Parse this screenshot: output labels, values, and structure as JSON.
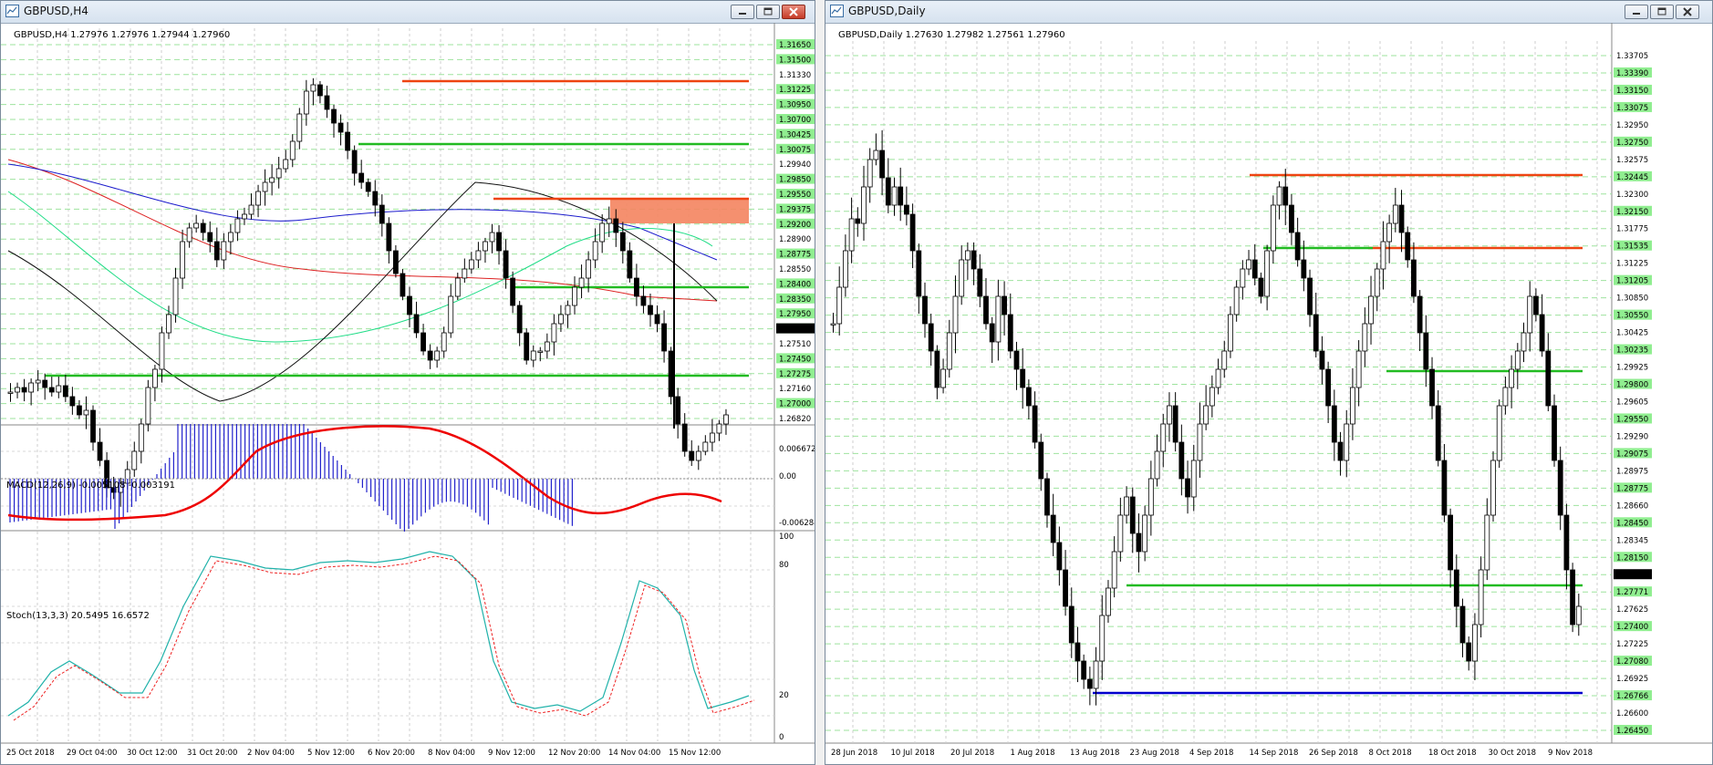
{
  "windows": {
    "left": {
      "title": "GBPUSD,H4"
    },
    "right": {
      "title": "GBPUSD,Daily"
    }
  },
  "left_chart": {
    "header": "GBPUSD,H4  1.27976 1.27976 1.27944 1.27960",
    "price_labels": [
      "1.31650",
      "1.31500",
      "1.31330",
      "1.31225",
      "1.30950",
      "1.30700",
      "1.30425",
      "1.30075",
      "1.29940",
      "1.29850",
      "1.29550",
      "1.29375",
      "1.29200",
      "1.28900",
      "1.28775",
      "1.28550",
      "1.28400",
      "1.28350",
      "1.27950",
      "1.27860",
      "1.27510",
      "1.27450",
      "1.27275",
      "1.27160",
      "1.27000",
      "1.26820"
    ],
    "macd_header": "MACD(12,26,9) -0.005108 -0.003191",
    "macd_labels": [
      "0.006672",
      "0.00",
      "-0.006284"
    ],
    "stoch_header": "Stoch(13,3,3) 20.5495 16.6572",
    "stoch_labels": [
      "100",
      "80",
      "20",
      "0"
    ],
    "time_labels": [
      "25 Oct 2018",
      "29 Oct 04:00",
      "30 Oct 12:00",
      "31 Oct 20:00",
      "2 Nov 04:00",
      "5 Nov 12:00",
      "6 Nov 20:00",
      "8 Nov 04:00",
      "9 Nov 12:00",
      "12 Nov 20:00",
      "14 Nov 04:00",
      "15 Nov 12:00"
    ]
  },
  "right_chart": {
    "header": "GBPUSD,Daily  1.27630 1.27982 1.27561 1.27960",
    "price_labels": [
      "1.33705",
      "1.33390",
      "1.33150",
      "1.33075",
      "1.32950",
      "1.32750",
      "1.32575",
      "1.32445",
      "1.32300",
      "1.32150",
      "1.31775",
      "1.31535",
      "1.31225",
      "1.31205",
      "1.30850",
      "1.30550",
      "1.30425",
      "1.30235",
      "1.29925",
      "1.29800",
      "1.29605",
      "1.29550",
      "1.29290",
      "1.29075",
      "1.28975",
      "1.28775",
      "1.28660",
      "1.28450",
      "1.28345",
      "1.28150",
      "1.27960",
      "1.27771",
      "1.27625",
      "1.27400",
      "1.27225",
      "1.27080",
      "1.26925",
      "1.26766",
      "1.26600",
      "1.26450"
    ],
    "time_labels": [
      "28 Jun 2018",
      "10 Jul 2018",
      "20 Jul 2018",
      "1 Aug 2018",
      "13 Aug 2018",
      "23 Aug 2018",
      "4 Sep 2018",
      "14 Sep 2018",
      "26 Sep 2018",
      "8 Oct 2018",
      "18 Oct 2018",
      "30 Oct 2018",
      "9 Nov 2018"
    ]
  },
  "colors": {
    "support": "#22bb22",
    "resistance": "#ee4411",
    "blue_line": "#0000cc",
    "macd_signal": "#ee0000",
    "macd_hist": "#2222cc",
    "stoch_main": "#20b2aa",
    "stoch_signal": "#ee2222",
    "price_label_bg": "#90ee90"
  }
}
